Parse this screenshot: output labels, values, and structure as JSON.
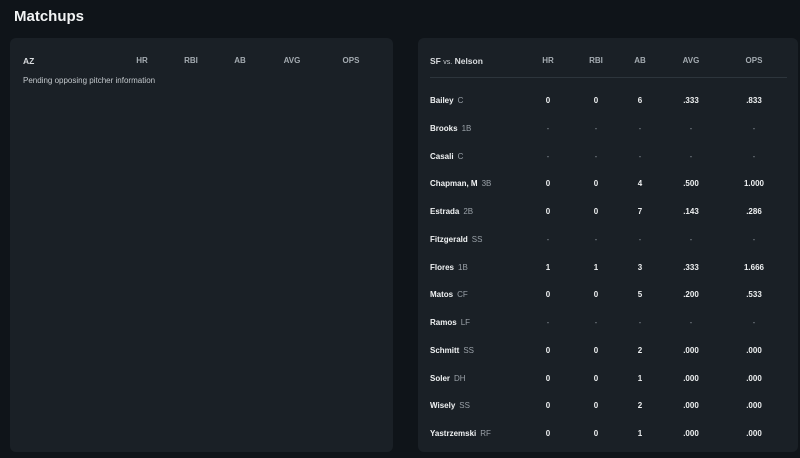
{
  "page_title": "Matchups",
  "columns": [
    "HR",
    "RBI",
    "AB",
    "AVG",
    "OPS"
  ],
  "away": {
    "team": "AZ",
    "message": "Pending opposing pitcher information"
  },
  "home": {
    "team": "SF",
    "vs": "vs.",
    "pitcher": "Nelson",
    "rows": [
      {
        "name": "Bailey",
        "pos": "C",
        "hr": "0",
        "rbi": "0",
        "ab": "6",
        "avg": ".333",
        "ops": ".833"
      },
      {
        "name": "Brooks",
        "pos": "1B",
        "hr": "-",
        "rbi": "-",
        "ab": "-",
        "avg": "-",
        "ops": "-"
      },
      {
        "name": "Casali",
        "pos": "C",
        "hr": "-",
        "rbi": "-",
        "ab": "-",
        "avg": "-",
        "ops": "-"
      },
      {
        "name": "Chapman, M",
        "pos": "3B",
        "hr": "0",
        "rbi": "0",
        "ab": "4",
        "avg": ".500",
        "ops": "1.000"
      },
      {
        "name": "Estrada",
        "pos": "2B",
        "hr": "0",
        "rbi": "0",
        "ab": "7",
        "avg": ".143",
        "ops": ".286"
      },
      {
        "name": "Fitzgerald",
        "pos": "SS",
        "hr": "-",
        "rbi": "-",
        "ab": "-",
        "avg": "-",
        "ops": "-"
      },
      {
        "name": "Flores",
        "pos": "1B",
        "hr": "1",
        "rbi": "1",
        "ab": "3",
        "avg": ".333",
        "ops": "1.666"
      },
      {
        "name": "Matos",
        "pos": "CF",
        "hr": "0",
        "rbi": "0",
        "ab": "5",
        "avg": ".200",
        "ops": ".533"
      },
      {
        "name": "Ramos",
        "pos": "LF",
        "hr": "-",
        "rbi": "-",
        "ab": "-",
        "avg": "-",
        "ops": "-"
      },
      {
        "name": "Schmitt",
        "pos": "SS",
        "hr": "0",
        "rbi": "0",
        "ab": "2",
        "avg": ".000",
        "ops": ".000"
      },
      {
        "name": "Soler",
        "pos": "DH",
        "hr": "0",
        "rbi": "0",
        "ab": "1",
        "avg": ".000",
        "ops": ".000"
      },
      {
        "name": "Wisely",
        "pos": "SS",
        "hr": "0",
        "rbi": "0",
        "ab": "2",
        "avg": ".000",
        "ops": ".000"
      },
      {
        "name": "Yastrzemski",
        "pos": "RF",
        "hr": "0",
        "rbi": "0",
        "ab": "1",
        "avg": ".000",
        "ops": ".000"
      }
    ]
  }
}
